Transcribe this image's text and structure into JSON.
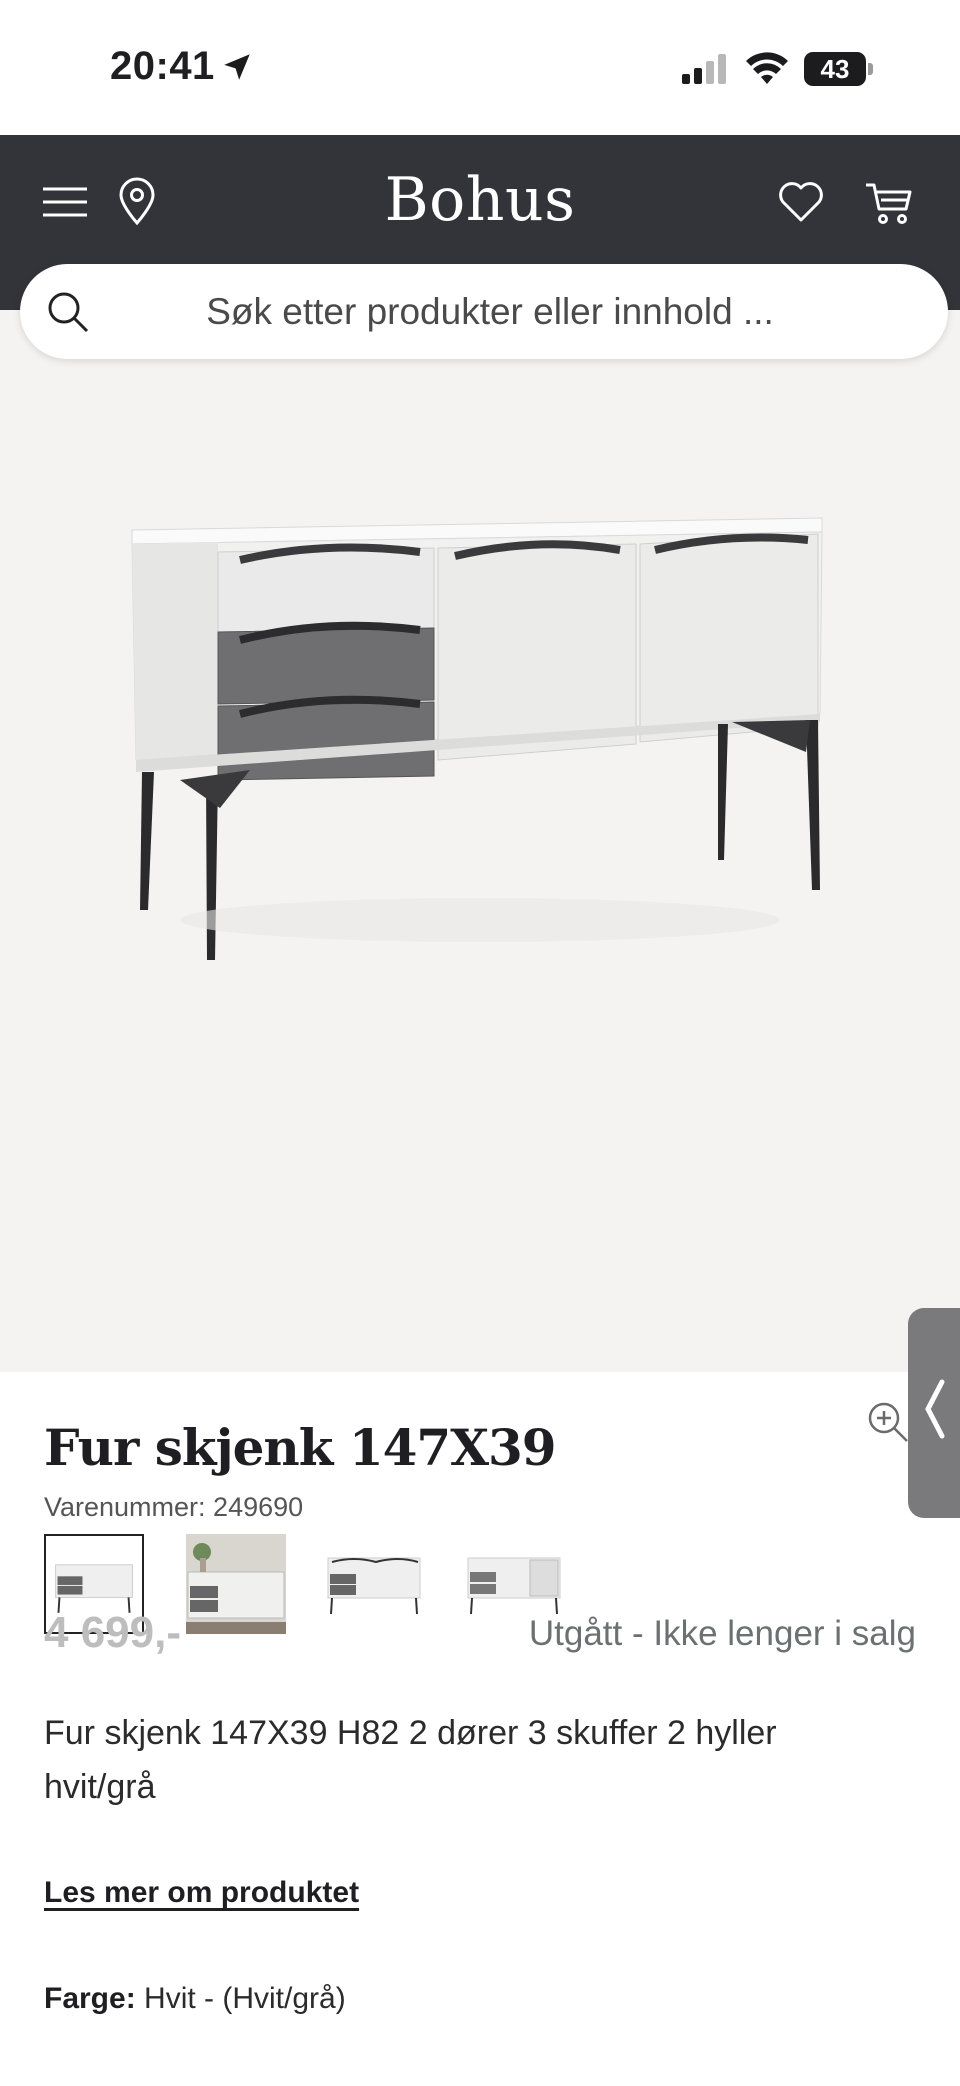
{
  "status_bar": {
    "time": "20:41",
    "battery": "43"
  },
  "header": {
    "logo": "Bohus"
  },
  "search": {
    "placeholder": "Søk etter produkter eller innhold ..."
  },
  "gallery": {
    "thumbnail_count": 4,
    "active_index": 0
  },
  "product": {
    "title": "Fur skjenk 147X39",
    "sku": "Varenummer: 249690",
    "price": "4 699,-",
    "availability": "Utgått - Ikke lenger i salg",
    "description": "Fur skjenk 147X39 H82 2 dører 3 skuffer 2 hyller hvit/grå",
    "read_more": "Les mer om produktet",
    "color_label": "Farge:",
    "color_value": "Hvit - (Hvit/grå)"
  },
  "icons": {
    "menu": "menu-icon",
    "location": "location-pin-icon",
    "wishlist": "heart-icon",
    "cart": "cart-icon",
    "search": "search-icon",
    "zoom": "zoom-in-icon",
    "side_tab": "chevron-left-icon"
  },
  "colors": {
    "header_bg": "#33333a",
    "gallery_bg": "#f4f3f1",
    "muted_price": "#bdbdbd"
  }
}
